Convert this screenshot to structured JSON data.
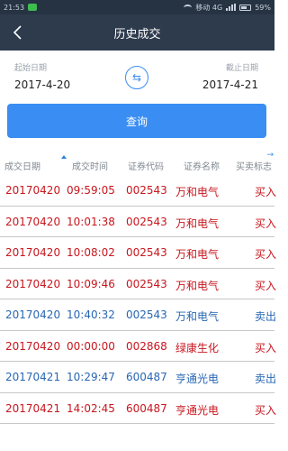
{
  "status_bar": {
    "time": "21:53",
    "network": "移动 4G",
    "battery": "59%"
  },
  "nav": {
    "title": "历史成交"
  },
  "dates": {
    "start_label": "起始日期",
    "start_value": "2017-4-20",
    "end_label": "截止日期",
    "end_value": "2017-4-21",
    "swap_glyph": "⇆"
  },
  "query_label": "查询",
  "table": {
    "headers": [
      "成交日期",
      "成交时间",
      "证券代码",
      "证券名称",
      "买卖标志"
    ],
    "scroll_glyph": "→",
    "rows": [
      {
        "date": "20170420",
        "time": "09:59:05",
        "code": "002543",
        "name": "万和电气",
        "type": "买入",
        "color": "#c8161e"
      },
      {
        "date": "20170420",
        "time": "10:01:38",
        "code": "002543",
        "name": "万和电气",
        "type": "买入",
        "color": "#c8161e"
      },
      {
        "date": "20170420",
        "time": "10:08:02",
        "code": "002543",
        "name": "万和电气",
        "type": "买入",
        "color": "#c8161e"
      },
      {
        "date": "20170420",
        "time": "10:09:46",
        "code": "002543",
        "name": "万和电气",
        "type": "买入",
        "color": "#c8161e"
      },
      {
        "date": "20170420",
        "time": "10:40:32",
        "code": "002543",
        "name": "万和电气",
        "type": "卖出",
        "color": "#2867b3"
      },
      {
        "date": "20170420",
        "time": "00:00:00",
        "code": "002868",
        "name": "绿康生化",
        "type": "买入",
        "color": "#c8161e"
      },
      {
        "date": "20170421",
        "time": "10:29:47",
        "code": "600487",
        "name": "亨通光电",
        "type": "卖出",
        "color": "#2867b3"
      },
      {
        "date": "20170421",
        "time": "14:02:45",
        "code": "600487",
        "name": "亨通光电",
        "type": "买入",
        "color": "#c8161e"
      }
    ]
  }
}
